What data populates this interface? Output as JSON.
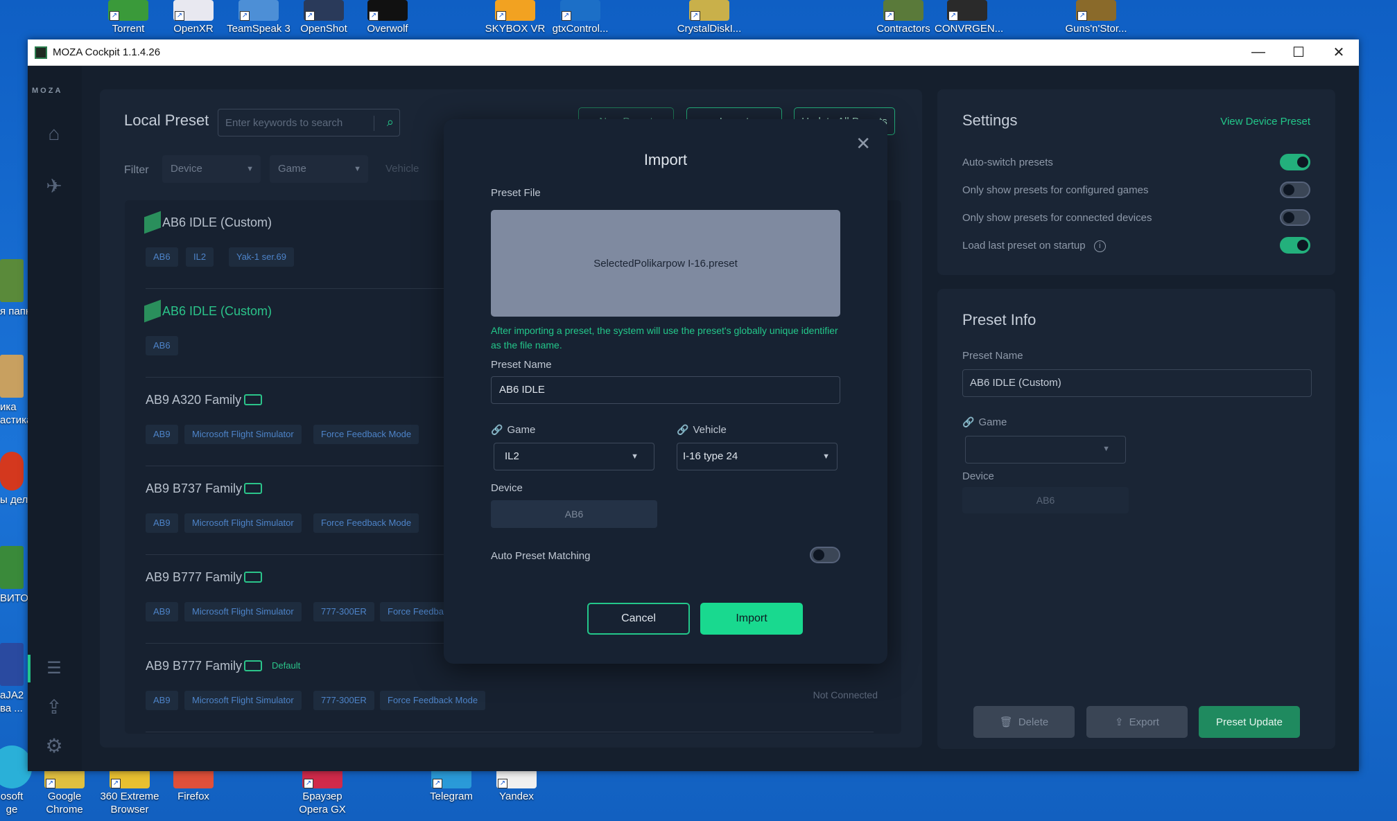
{
  "desktop": {
    "top_icons": [
      "Torrent",
      "OpenXR",
      "TeamSpeak 3",
      "OpenShot",
      "Overwolf",
      "SKYBOX VR",
      "gtxControl...",
      "CrystalDiskI...",
      "Contractors",
      "CONVRGEN...",
      "Guns'n'Stor..."
    ],
    "bottom_icons": [
      {
        "l1": "osoft",
        "l2": "ge"
      },
      {
        "l1": "Google",
        "l2": "Chrome"
      },
      {
        "l1": "360 Extreme",
        "l2": "Browser"
      },
      {
        "l1": "Firefox",
        "l2": ""
      },
      {
        "l1": "Браузер",
        "l2": "Opera GX"
      },
      {
        "l1": "Telegram",
        "l2": ""
      },
      {
        "l1": "Yandex",
        "l2": ""
      }
    ],
    "left_icons": [
      {
        "l1": "я папк",
        "l2": ""
      },
      {
        "l1": "ика",
        "l2": "астика"
      },
      {
        "l1": "ы дела",
        "l2": ""
      },
      {
        "l1": "ВИТО",
        "l2": ""
      },
      {
        "l1": "aJA2",
        "l2": "ва ..."
      }
    ]
  },
  "window": {
    "title": "MOZA Cockpit 1.1.4.26",
    "minimize": "—",
    "maximize": "☐",
    "close": "✕"
  },
  "sidebar": {
    "logo": "MOZA",
    "home_icon": "⌂",
    "plane_icon": "✈",
    "sliders_icon": "☰",
    "upload_icon": "⇪",
    "gear_icon": "⚙"
  },
  "local_preset": {
    "title": "Local Preset",
    "search_placeholder": "Enter keywords to search",
    "new_preset": "New Preset",
    "import": "Import",
    "update_all": "Update All Presets",
    "filter_label": "Filter",
    "filter_device": "Device",
    "filter_game": "Game",
    "filter_vehicle": "Vehicle",
    "not_connected": "Not Connected",
    "presets": [
      {
        "name": "AB6 IDLE (Custom)",
        "tags": [
          "AB6",
          "IL2",
          "Yak-1 ser.69"
        ]
      },
      {
        "name": "AB6 IDLE (Custom)",
        "tags": [
          "AB6"
        ]
      },
      {
        "name": "AB9 A320 Family",
        "tags": [
          "AB9",
          "Microsoft Flight Simulator",
          "Force Feedback Mode"
        ]
      },
      {
        "name": "AB9 B737 Family",
        "tags": [
          "AB9",
          "Microsoft Flight Simulator",
          "Force Feedback Mode"
        ]
      },
      {
        "name": "AB9 B777 Family",
        "tags": [
          "AB9",
          "Microsoft Flight Simulator",
          "777-300ER",
          "Force Feedback Mode"
        ]
      },
      {
        "name": "AB9 B777 Family",
        "default": "Default",
        "tags": [
          "AB9",
          "Microsoft Flight Simulator",
          "777-300ER",
          "Force Feedback Mode"
        ]
      }
    ]
  },
  "settings": {
    "title": "Settings",
    "view_device_preset": "View Device Preset",
    "rows": [
      {
        "label": "Auto-switch presets",
        "on": true
      },
      {
        "label": "Only show presets for configured games",
        "on": false
      },
      {
        "label": "Only show presets for connected devices",
        "on": false
      },
      {
        "label": "Load last preset on startup",
        "on": true
      }
    ],
    "info_icon": "i"
  },
  "preset_info": {
    "title": "Preset Info",
    "name_label": "Preset Name",
    "name_value": "AB6 IDLE (Custom)",
    "game_label": "Game",
    "device_label": "Device",
    "device_value": "AB6",
    "delete": "Delete",
    "export": "Export",
    "preset_update": "Preset Update"
  },
  "modal": {
    "title": "Import",
    "close": "✕",
    "preset_file_label": "Preset File",
    "file_name": "SelectedPolikarpow I-16.preset",
    "note": "After importing a preset, the system will use the preset's globally unique identifier as the file name.",
    "preset_name_label": "Preset Name",
    "preset_name_value": "AB6 IDLE",
    "game_label": "Game",
    "game_value": "IL2",
    "vehicle_label": "Vehicle",
    "vehicle_value": "I-16 type 24",
    "device_label": "Device",
    "device_value": "AB6",
    "auto_match_label": "Auto Preset Matching",
    "auto_match_on": false,
    "cancel": "Cancel",
    "import": "Import"
  },
  "colors": {
    "accent": "#23c78a",
    "window_bg": "#151f2d",
    "panel_bg": "#1a2535",
    "tag_text": "#4d83c8"
  }
}
